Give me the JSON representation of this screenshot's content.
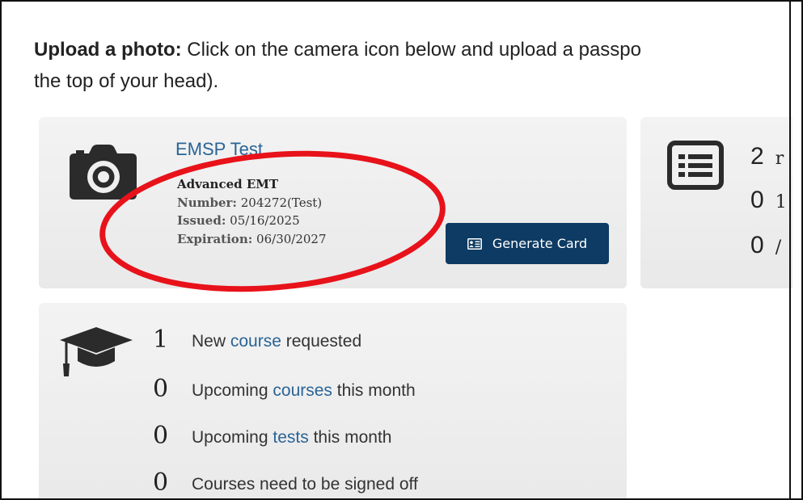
{
  "intro": {
    "bold": "Upload a photo:",
    "line1": " Click on the camera icon below and upload a passpo",
    "line2": "the top of your head)."
  },
  "profile": {
    "name": "EMSP Test",
    "title": "Advanced EMT",
    "number_label": "Number:",
    "number_value": "204272(Test)",
    "issued_label": "Issued:",
    "issued_value": "05/16/2025",
    "expiration_label": "Expiration:",
    "expiration_value": "06/30/2027",
    "generate_label": "Generate Card"
  },
  "stats": {
    "items": [
      {
        "count": "2",
        "label": "r"
      },
      {
        "count": "0",
        "label": "1"
      },
      {
        "count": "0",
        "label": "/"
      }
    ]
  },
  "courses": {
    "rows": [
      {
        "count": "1",
        "pre": "New ",
        "link": "course",
        "post": " requested"
      },
      {
        "count": "0",
        "pre": "Upcoming ",
        "link": "courses",
        "post": " this month"
      },
      {
        "count": "0",
        "pre": "Upcoming ",
        "link": "tests",
        "post": " this month"
      },
      {
        "count": "0",
        "pre": "Courses need to be signed off",
        "link": "",
        "post": ""
      }
    ]
  },
  "colors": {
    "link": "#2a6496",
    "button": "#0e3b63",
    "annotation": "#e8121a"
  },
  "icons": [
    "camera-icon",
    "id-card-icon",
    "list-icon",
    "graduation-cap-icon"
  ]
}
